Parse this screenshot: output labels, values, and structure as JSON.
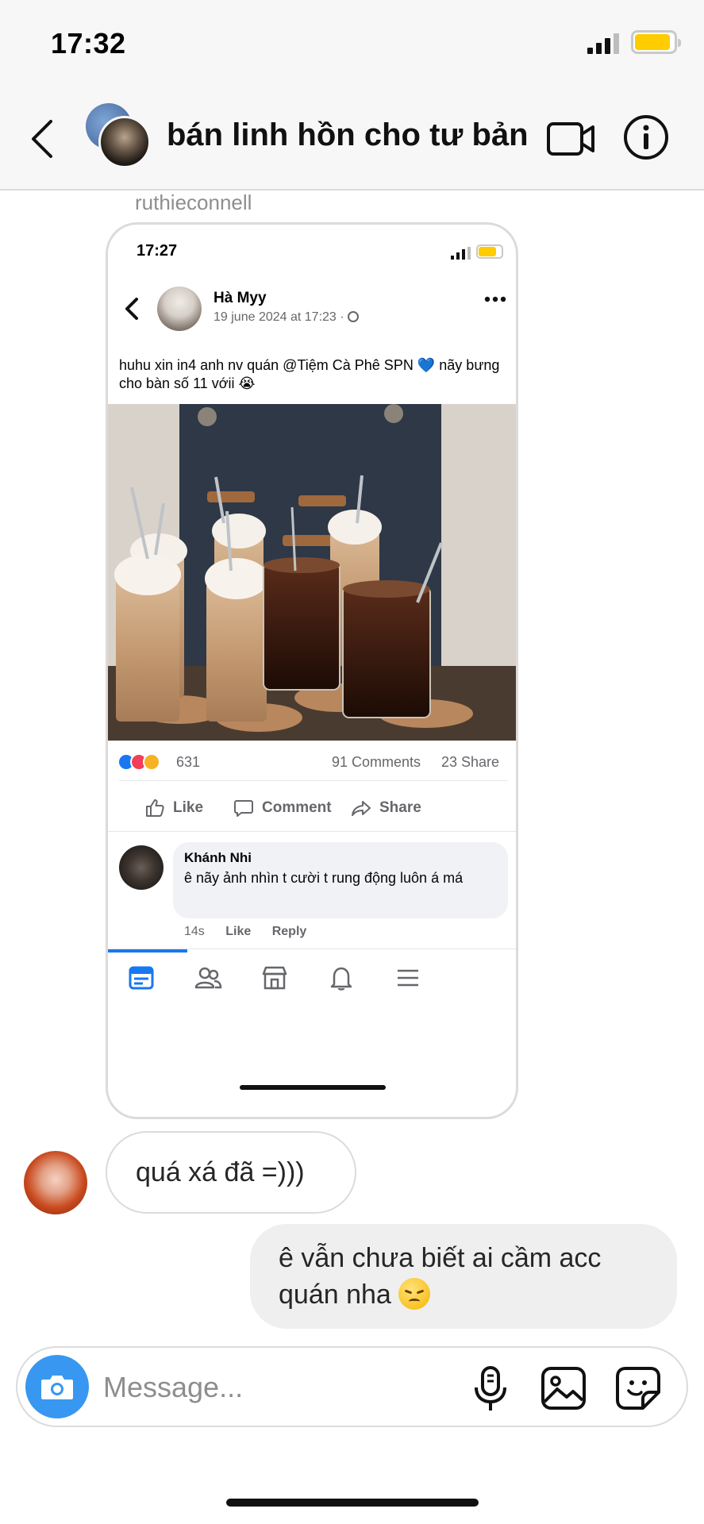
{
  "status_bar": {
    "time": "17:32",
    "battery_level": 0.85
  },
  "header": {
    "title": "bán linh hồn cho tư bản"
  },
  "shared_post": {
    "sender": "ruthieconnell",
    "status_time": "17:27",
    "author": "Hà Myy",
    "date": "19 june 2024 at 17:23 ·",
    "caption_part1": "huhu xin in4 anh nv quán @Tiệm Cà Phê SPN",
    "caption_emoji": "💙",
    "caption_part2": "nãy bưng cho bàn số 11 vớii 😭",
    "reaction_count": "631",
    "comments": "91 Comments",
    "shares": "23 Share",
    "actions": {
      "like": "Like",
      "comment": "Comment",
      "share": "Share"
    },
    "comment": {
      "name": "Khánh Nhi",
      "text": "ê nãy ảnh nhìn t cười t rung động luôn á má",
      "time": "14s",
      "like": "Like",
      "reply": "Reply"
    },
    "nav_icons": [
      "feed-icon",
      "friends-icon",
      "marketplace-icon",
      "bell-icon",
      "menu-icon"
    ],
    "accent": "#1877f2"
  },
  "messages": {
    "incoming": "quá xá đã =)))",
    "outgoing": "ê vẫn chưa biết ai cầm acc quán nha"
  },
  "composer": {
    "placeholder": "Message..."
  },
  "colors": {
    "ig_blue": "#3897f0",
    "battery": "#ffcc00"
  }
}
